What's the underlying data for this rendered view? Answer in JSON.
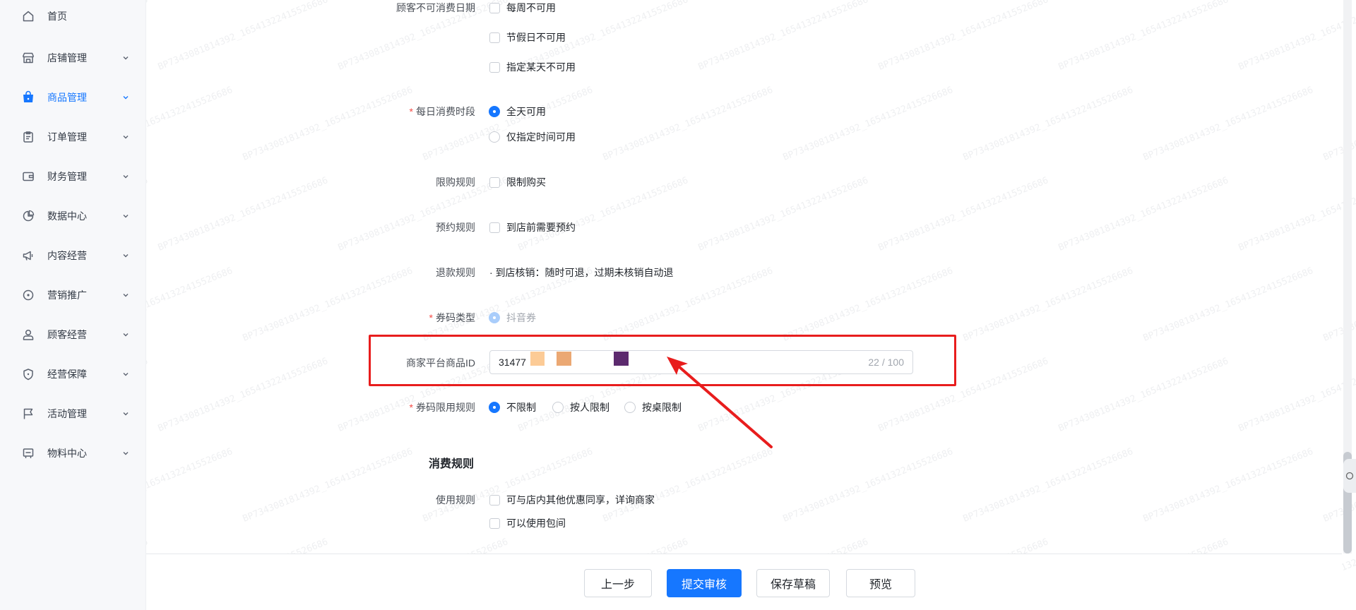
{
  "sidebar": {
    "items": [
      {
        "label": "首页",
        "icon": "home-icon",
        "active": false
      },
      {
        "label": "店铺管理",
        "icon": "store-icon",
        "active": false
      },
      {
        "label": "商品管理",
        "icon": "product-bag-icon",
        "active": true
      },
      {
        "label": "订单管理",
        "icon": "order-clipboard-icon",
        "active": false
      },
      {
        "label": "财务管理",
        "icon": "wallet-icon",
        "active": false
      },
      {
        "label": "数据中心",
        "icon": "pie-chart-icon",
        "active": false
      },
      {
        "label": "内容经营",
        "icon": "megaphone-icon",
        "active": false
      },
      {
        "label": "营销推广",
        "icon": "location-pin-icon",
        "active": false
      },
      {
        "label": "顾客经营",
        "icon": "user-icon",
        "active": false
      },
      {
        "label": "经营保障",
        "icon": "shield-icon",
        "active": false
      },
      {
        "label": "活动管理",
        "icon": "flag-icon",
        "active": false
      },
      {
        "label": "物料中心",
        "icon": "board-icon",
        "active": false
      }
    ]
  },
  "form": {
    "unavailable_dates": {
      "label": "顾客不可消费日期",
      "options": [
        "每周不可用",
        "节假日不可用",
        "指定某天不可用"
      ]
    },
    "daily_time": {
      "required_mark": "*",
      "label": "每日消费时段",
      "options": [
        {
          "label": "全天可用",
          "selected": true
        },
        {
          "label": "仅指定时间可用",
          "selected": false
        }
      ]
    },
    "purchase_limit": {
      "label": "限购规则",
      "option": "限制购买"
    },
    "reservation": {
      "label": "预约规则",
      "option": "到店前需要预约"
    },
    "refund": {
      "label": "退款规则",
      "text": "· 到店核销：随时可退，过期未核销自动退"
    },
    "coupon_type": {
      "required_mark": "*",
      "label": "券码类型",
      "option": "抖音券"
    },
    "merchant_product_id": {
      "label": "商家平台商品ID",
      "value": "31477",
      "counter": "22 / 100"
    },
    "coupon_limit": {
      "required_mark": "*",
      "label": "券码限用规则",
      "options": [
        {
          "label": "不限制",
          "selected": true
        },
        {
          "label": "按人限制",
          "selected": false
        },
        {
          "label": "按桌限制",
          "selected": false
        }
      ]
    },
    "consumption_section_title": "消费规则",
    "usage_rules": {
      "label": "使用规则",
      "options": [
        "可与店内其他优惠同享，详询商家",
        "可以使用包间"
      ]
    }
  },
  "footer": {
    "prev_label": "上一步",
    "submit_label": "提交审核",
    "draft_label": "保存草稿",
    "preview_label": "预览"
  },
  "watermark_text": "BP7343081814392_16541322415526686",
  "colors": {
    "primary": "#1677ff",
    "required": "#f54a45",
    "highlight": "#e81d1d",
    "redact_1": "#fccb96",
    "redact_2": "#eba873",
    "redact_3": "#5c2a6e"
  }
}
